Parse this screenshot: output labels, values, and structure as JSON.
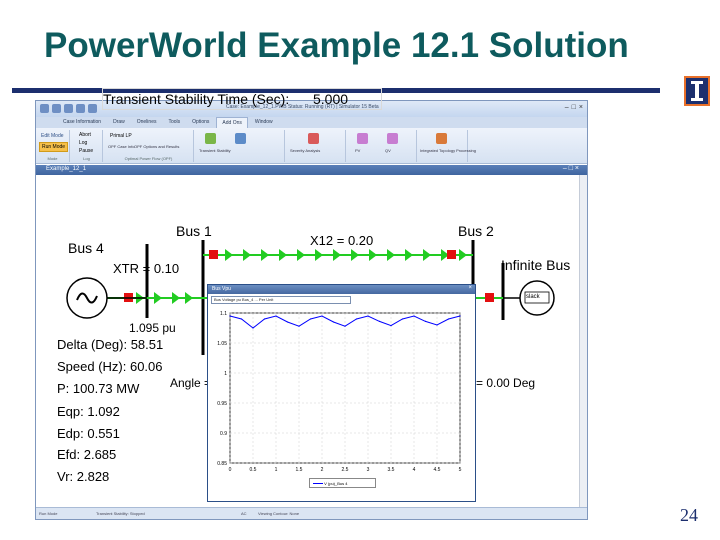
{
  "slide": {
    "title": "PowerWorld Example 12.1 Solution",
    "page_number": "24"
  },
  "app": {
    "window_title": "Case: Example_12_1.PWB Status: Running (RT) | Simulator 15 Beta",
    "tabs": [
      "Case Information",
      "Draw",
      "Onelines",
      "Tools",
      "Options",
      "Add Ons",
      "Window"
    ],
    "active_tab": "Add Ons",
    "ribbon": {
      "edit_mode": "Edit Mode",
      "run_mode": "Run Mode",
      "mode_group": "Mode",
      "abort": "Abort",
      "log": "Log",
      "pause": "Pause",
      "log_group": "Log",
      "primal_lp": "Primal LP",
      "opf_group": "Optimal Power Flow (OPF)",
      "ribbon_labels": [
        "OPF Case Info",
        "OPF Options and Results",
        "OPF Case Info",
        "Transient Stability",
        "Severity Analysis",
        "PV",
        "QV",
        "Integrated Topology Processing"
      ]
    },
    "oneline_window_title": "Example_12_1",
    "status_items": [
      "Run Mode",
      "Transient Stability: Stopped",
      "AC",
      "Viewing Contour: None"
    ]
  },
  "oneline": {
    "ts_label": "Transient Stability Time (Sec):",
    "ts_value": "5.000",
    "bus1": "Bus 1",
    "bus2": "Bus 2",
    "bus4": "Bus 4",
    "x12": "X12 = 0.20",
    "xtr": "XTR = 0.10",
    "infinite_bus": "Infinite Bus",
    "voltage": "1.095 pu",
    "delta": "Delta (Deg): 58.51",
    "speed": "Speed (Hz):  60.06",
    "p": "P: 100.73 MW",
    "eqp": "Eqp:  1.092",
    "edp": "Edp: 0.551",
    "efd": "Efd: 2.685",
    "vr": "Vr: 2.828",
    "angle_label": "Angle =",
    "angle_value": "=   0.00 Deg",
    "slack_label": "slack"
  },
  "plot": {
    "window_title": "Bus Vpu",
    "field_text": "Bus Voltage pu Bus_4 ... Per Unit",
    "legend": "V (pu)_Bus 4"
  },
  "colors": {
    "title": "#0e5b5e",
    "rule": "#1c2f6e",
    "line_green": "#22cc22",
    "breaker_red": "#e31010",
    "plot_series": "#0000ff"
  },
  "chart_data": {
    "type": "line",
    "title": "",
    "xlabel": "",
    "ylabel": "",
    "xlim": [
      0,
      5
    ],
    "ylim": [
      0.85,
      1.1
    ],
    "x_ticks": [
      "0",
      "0.5",
      "1",
      "1.5",
      "2",
      "2.5",
      "3",
      "3.5",
      "4",
      "4.5",
      "5"
    ],
    "y_ticks": [
      "1.1",
      "1.05",
      "1",
      "0.95",
      "0.9",
      "0.85"
    ],
    "series": [
      {
        "name": "V (pu)_Bus 4",
        "x": [
          0,
          0.25,
          0.5,
          0.75,
          1.0,
          1.25,
          1.5,
          1.75,
          2.0,
          2.25,
          2.5,
          2.75,
          3.0,
          3.25,
          3.5,
          3.75,
          4.0,
          4.25,
          4.5,
          4.75,
          5.0
        ],
        "values": [
          1.095,
          1.09,
          1.075,
          1.09,
          1.095,
          1.085,
          1.078,
          1.09,
          1.095,
          1.085,
          1.078,
          1.09,
          1.095,
          1.086,
          1.079,
          1.09,
          1.095,
          1.086,
          1.08,
          1.09,
          1.095
        ]
      }
    ]
  }
}
